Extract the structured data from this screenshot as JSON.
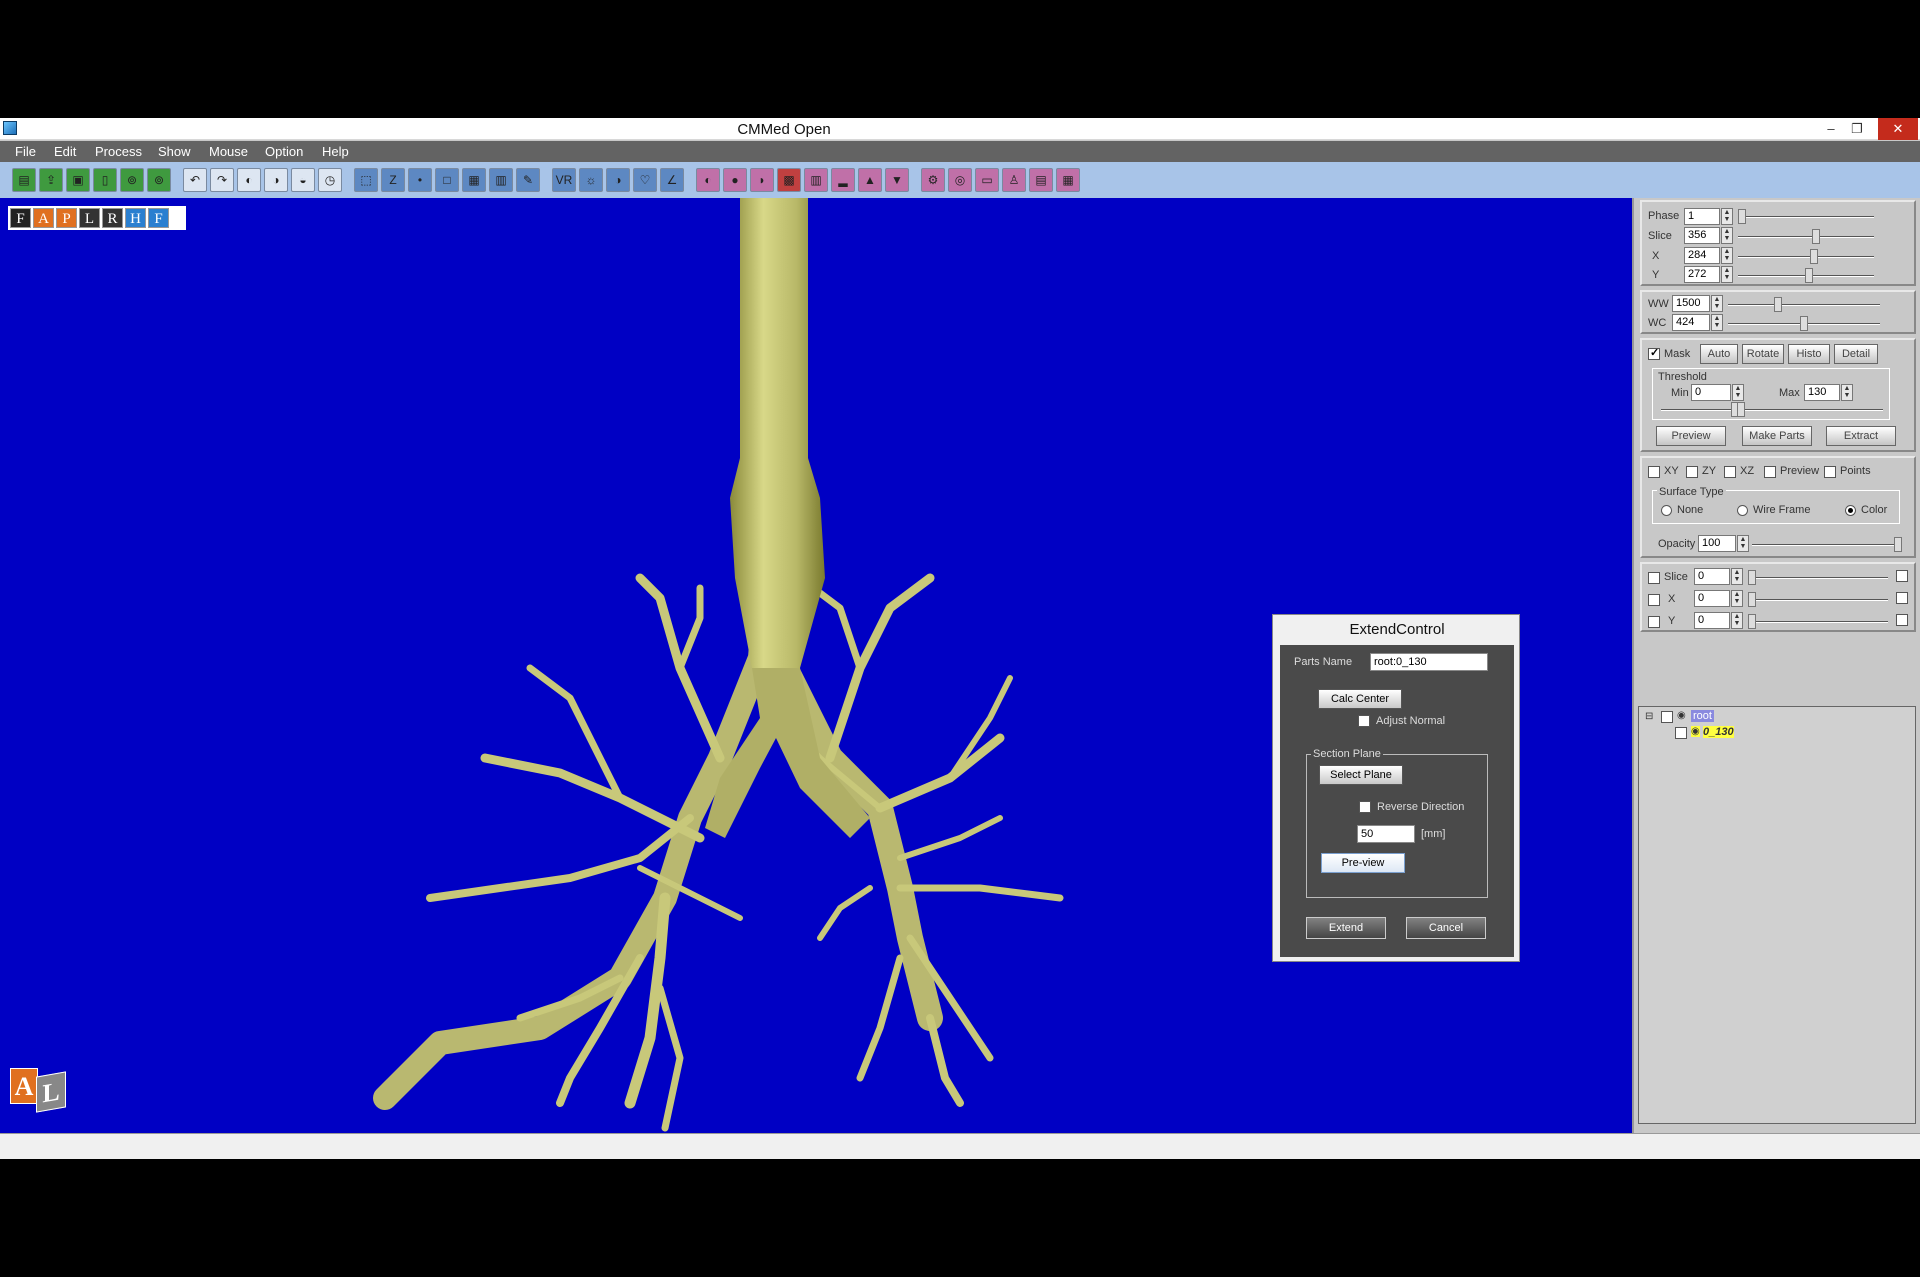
{
  "window": {
    "title": "CMMed  Open",
    "minimize": "–",
    "restore": "❐",
    "close": "✕"
  },
  "menu": [
    "File",
    "Edit",
    "Process",
    "Show",
    "Mouse",
    "Option",
    "Help"
  ],
  "toolbar": {
    "buttons": [
      "open",
      "import",
      "save",
      "view",
      "zoom-a",
      "zoom-b",
      "undo",
      "redo",
      "cam1",
      "cam2",
      "cam3",
      "clock",
      "fit",
      "zoom",
      "point",
      "region",
      "grid",
      "measure",
      "edit",
      "VR",
      "light",
      "contrast",
      "heart",
      "angle",
      "mask",
      "sphere",
      "half",
      "dots",
      "report",
      "export",
      "scale",
      "tool",
      "vessel",
      "stat",
      "scope",
      "bar",
      "person",
      "print"
    ]
  },
  "viewport": {
    "background": "#0000c4",
    "orientation": [
      "F",
      "A",
      "P",
      "L",
      "R",
      "H",
      "F"
    ],
    "logo": [
      "A",
      "L"
    ]
  },
  "panel": {
    "phase": {
      "label": "Phase",
      "value": "1",
      "level": 0.0
    },
    "slice": {
      "label": "Slice",
      "value": "356",
      "level": 0.58
    },
    "x": {
      "label": "X",
      "value": "284",
      "level": 0.56
    },
    "y": {
      "label": "Y",
      "value": "272",
      "level": 0.52
    },
    "ww": {
      "label": "WW",
      "value": "1500",
      "level": 0.32
    },
    "wc": {
      "label": "WC",
      "value": "424",
      "level": 0.5
    },
    "mask": {
      "label": "Mask",
      "checked": true,
      "auto": "Auto",
      "rotate": "Rotate",
      "histo": "Histo",
      "detail": "Detail"
    },
    "threshold": {
      "label": "Threshold",
      "min_label": "Min",
      "min": "0",
      "max_label": "Max",
      "max": "130"
    },
    "actions": {
      "preview": "Preview",
      "make_parts": "Make Parts",
      "extract": "Extract"
    },
    "planes": {
      "xy": "XY",
      "zy": "ZY",
      "xz": "XZ",
      "preview": "Preview",
      "points": "Points"
    },
    "surface": {
      "label": "Surface Type",
      "none": "None",
      "wire": "Wire Frame",
      "color": "Color",
      "selected": "color"
    },
    "opacity": {
      "label": "Opacity",
      "value": "100",
      "level": 1.0
    },
    "cut": [
      {
        "label": "Slice",
        "value": "0"
      },
      {
        "label": "X",
        "value": "0"
      },
      {
        "label": "Y",
        "value": "0"
      }
    ],
    "tree": {
      "root": "root",
      "child": "0_130",
      "toggle": "⊟"
    }
  },
  "dialog": {
    "title": "ExtendControl",
    "parts_name_label": "Parts Name",
    "parts_name": "root:0_130",
    "calc_center": "Calc Center",
    "adjust_normal": "Adjust Normal",
    "section_plane": "Section Plane",
    "select_plane": "Select Plane",
    "reverse_direction": "Reverse Direction",
    "distance": "50",
    "unit": "[mm]",
    "preview": "Pre-view",
    "extend": "Extend",
    "cancel": "Cancel"
  }
}
